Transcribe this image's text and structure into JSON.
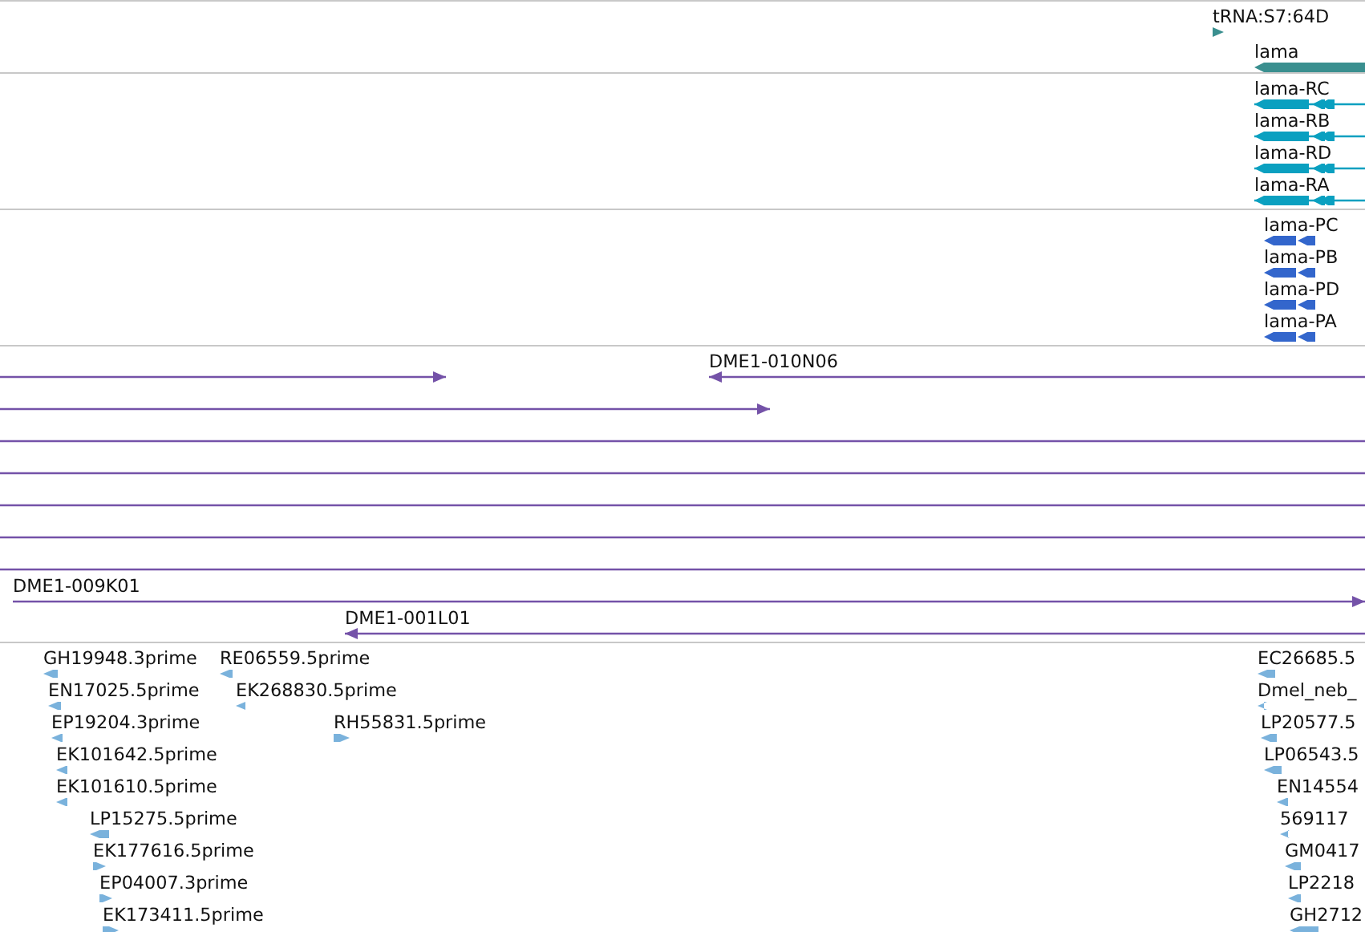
{
  "tracks": [
    {
      "kind": "gene",
      "features": [
        {
          "label": "tRNA:S7:64D",
          "reverse": false
        },
        {
          "label": "lama",
          "reverse": true
        }
      ]
    },
    {
      "kind": "transcript",
      "features": [
        {
          "label": "lama-RC",
          "reverse": true
        },
        {
          "label": "lama-RB",
          "reverse": true
        },
        {
          "label": "lama-RD",
          "reverse": true
        },
        {
          "label": "lama-RA",
          "reverse": true
        }
      ]
    },
    {
      "kind": "protein",
      "features": [
        {
          "label": "lama-PC",
          "reverse": true
        },
        {
          "label": "lama-PB",
          "reverse": true
        },
        {
          "label": "lama-PD",
          "reverse": true
        },
        {
          "label": "lama-PA",
          "reverse": true
        }
      ]
    },
    {
      "kind": "clone",
      "features": [
        {
          "kind": "arrow",
          "reverse": false
        },
        {
          "label": "DME1-010N06",
          "kind": "arrow",
          "reverse": true
        },
        {
          "kind": "arrow",
          "reverse": false
        },
        {
          "kind": "line"
        },
        {
          "kind": "line"
        },
        {
          "kind": "line"
        },
        {
          "kind": "line"
        },
        {
          "kind": "line"
        },
        {
          "label": "DME1-009K01",
          "kind": "arrow",
          "reverse": false
        },
        {
          "label": "DME1-001L01",
          "kind": "arrow",
          "reverse": true
        }
      ]
    },
    {
      "kind": "est",
      "features": [
        {
          "label": "GH19948.3prime",
          "reverse": true
        },
        {
          "label": "RE06559.5prime",
          "reverse": true
        },
        {
          "label": "EN17025.5prime",
          "reverse": true
        },
        {
          "label": "EK268830.5prime",
          "reverse": true
        },
        {
          "label": "EP19204.3prime",
          "reverse": true
        },
        {
          "label": "RH55831.5prime",
          "reverse": false
        },
        {
          "label": "EK101642.5prime",
          "reverse": true
        },
        {
          "label": "EK101610.5prime",
          "reverse": true
        },
        {
          "label": "LP15275.5prime",
          "reverse": true
        },
        {
          "label": "EK177616.5prime",
          "reverse": false
        },
        {
          "label": "EP04007.3prime",
          "reverse": false
        },
        {
          "label": "EK173411.5prime",
          "reverse": false
        },
        {
          "label": "EC26685.5",
          "reverse": true
        },
        {
          "label": "Dmel_neb_",
          "reverse": true
        },
        {
          "label": "LP20577.5",
          "reverse": true
        },
        {
          "label": "LP06543.5",
          "reverse": true
        },
        {
          "label": "EN14554",
          "reverse": true
        },
        {
          "label": "569117",
          "reverse": true
        },
        {
          "label": "GM0417",
          "reverse": true
        },
        {
          "label": "LP2218",
          "reverse": true
        },
        {
          "label": "GH2712",
          "reverse": true
        }
      ]
    }
  ]
}
